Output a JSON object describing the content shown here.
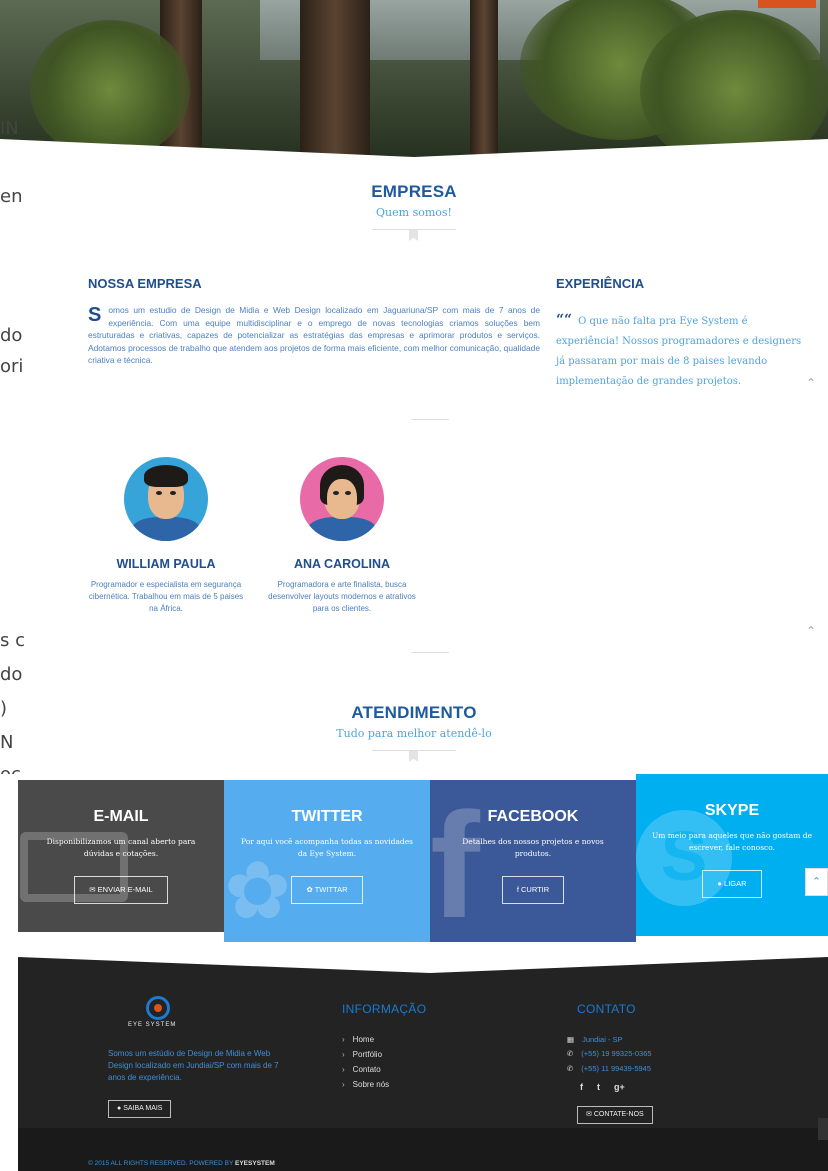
{
  "empresa": {
    "title": "EMPRESA",
    "subtitle": "Quem somos!",
    "nossa_title": "NOSSA EMPRESA",
    "dropcap": "S",
    "nossa_text": "omos um estudio de Design de Midia e Web Design localizado em Jaguariuna/SP com mais de 7 anos de experiência. Com uma equipe multidisciplinar e o emprego de novas tecnologias criamos soluções bem estruturadas e criativas, capazes de potencializar as estratégias das empresas e aprimorar produtos e serviços. Adotamos processos de trabalho que atendem aos projetos de forma mais eficiente, com melhor comunicação, qualidade criativa e técnica.",
    "exp_title": "EXPERIÊNCIA",
    "exp_quote": "O que não falta pra Eye System é experiência! Nossos programadores e designers já passaram por mais de 8 paises levando implementação de grandes projetos."
  },
  "team": [
    {
      "name": "WILLIAM PAULA",
      "desc": "Programador e especialista em segurança cibernética. Trabalhou em mais de 5 paises na África."
    },
    {
      "name": "ANA CAROLINA",
      "desc": "Programadora e arte finalista, busca desenvolver layouts modernos e atrativos para os clientes."
    }
  ],
  "atendimento": {
    "title": "ATENDIMENTO",
    "subtitle": "Tudo para melhor atendê-lo"
  },
  "panels": [
    {
      "title": "E-MAIL",
      "desc": "Disponibilizamos um canal aberto para dúvidas e cotações.",
      "button": "ENVIAR E-MAIL",
      "icon": "envelope-icon",
      "color": "#4a4a4a"
    },
    {
      "title": "TWITTER",
      "desc": "Por aqui você acompanha todas as novidades da Eye System.",
      "button": "TWITTAR",
      "icon": "twitter-icon",
      "color": "#55acee"
    },
    {
      "title": "FACEBOOK",
      "desc": "Detalhes dos nossos projetos e novos produtos.",
      "button": "CURTIR",
      "icon": "facebook-icon",
      "color": "#3b5998"
    },
    {
      "title": "SKYPE",
      "desc": "Um meio para aqueles que não gostam de escrever, fale conosco.",
      "button": "LIGAR",
      "icon": "skype-icon",
      "color": "#00aff0"
    }
  ],
  "footer": {
    "logo_text": "EYE SYSTEM",
    "about": "Somos um estúdio de Design de Midia e Web Design localizado em Jundiai/SP com mais de 7 anos de experiência.",
    "saiba_mais": "SAIBA MAIS",
    "info_title": "INFORMAÇÃO",
    "links": [
      "Home",
      "Portfólio",
      "Contato",
      "Sobre nós"
    ],
    "contato_title": "CONTATO",
    "city": "Jundiai - SP",
    "phone1": "(+55) 19 99325-0365",
    "phone2": "(+55) 11 99439-5945",
    "social": [
      "f",
      "t",
      "g+"
    ],
    "contate_nos": "CONTATE-NOS",
    "copyright": "© 2015 ALL RIGHTS RESERVED. POWERED BY",
    "powered_by": "EYESYSTEM"
  },
  "ghost_text": [
    "IN",
    "en",
    "do",
    "ori",
    "s c",
    "do",
    ")",
    "N",
    "oc"
  ],
  "colors": {
    "primary": "#1f4e8c",
    "accent": "#4ea3dd",
    "orange": "#d9531e"
  }
}
